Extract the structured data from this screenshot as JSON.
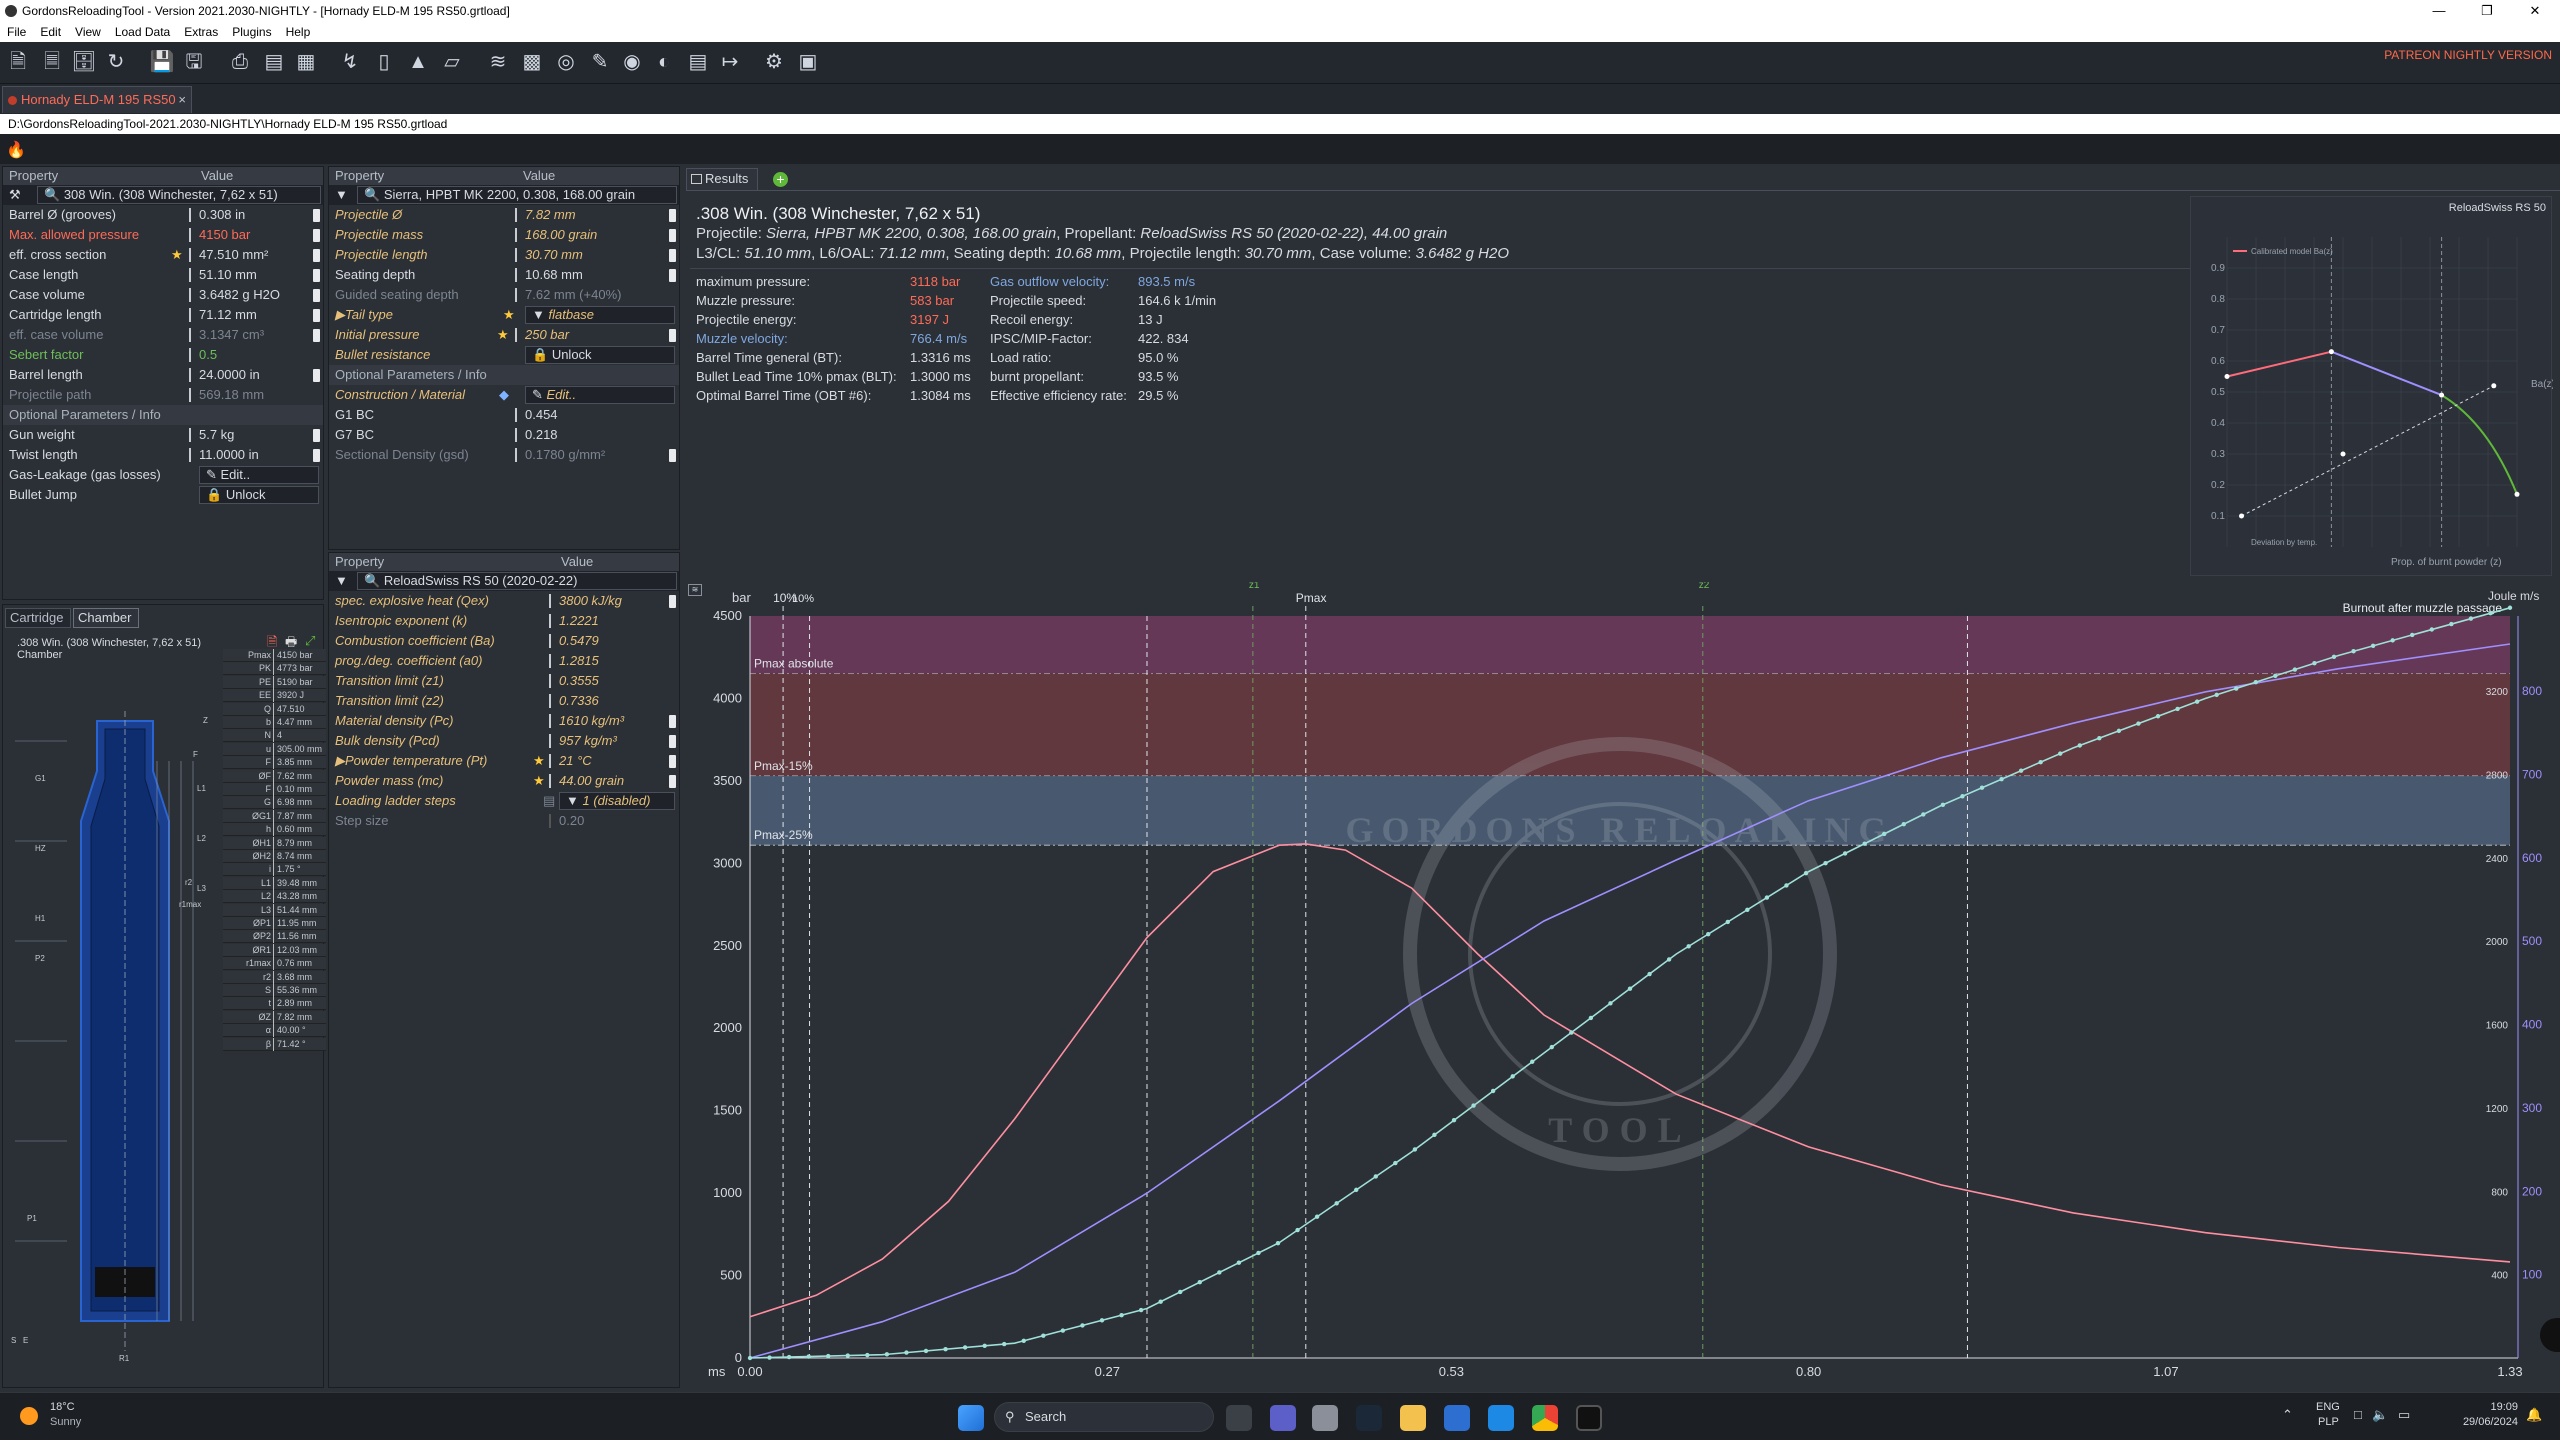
{
  "window": {
    "title": "GordonsReloadingTool - Version 2021.2030-NIGHTLY - [Hornady ELD-M 195 RS50.grtload]"
  },
  "menu": [
    "File",
    "Edit",
    "View",
    "Load Data",
    "Extras",
    "Plugins",
    "Help"
  ],
  "patreon": "PATREON NIGHTLY VERSION",
  "doc_tab": "Hornady ELD-M 195 RS50",
  "path": "D:\\GordonsReloadingTool-2021.2030-NIGHTLY\\Hornady ELD-M 195 RS50.grtload",
  "cartridge_panel": {
    "hdr_property": "Property",
    "hdr_value": "Value",
    "selector": "308 Win. (308 Winchester, 7,62 x 51)",
    "rows": [
      {
        "name": "Barrel Ø (grooves)",
        "value": "0.308 in"
      },
      {
        "name": "Max. allowed pressure",
        "value": "4150 bar"
      },
      {
        "name": "eff. cross section",
        "value": "47.510 mm²"
      },
      {
        "name": "Case length",
        "value": "51.10 mm"
      },
      {
        "name": "Case volume",
        "value": "3.6482 g H2O"
      },
      {
        "name": "Cartridge length",
        "value": "71.12 mm"
      },
      {
        "name": "eff. case volume",
        "value": "3.1347 cm³"
      },
      {
        "name": "Sebert factor",
        "value": "0.5"
      },
      {
        "name": "Barrel length",
        "value": "24.0000 in"
      },
      {
        "name": "Projectile path",
        "value": "569.18 mm"
      }
    ],
    "section_optional": "Optional Parameters / Info",
    "rows2": [
      {
        "name": "Gun weight",
        "value": "5.7 kg"
      },
      {
        "name": "Twist length",
        "value": "11.0000 in"
      },
      {
        "name": "Gas-Leakage (gas losses)",
        "value": "Edit.."
      },
      {
        "name": "Bullet Jump",
        "value": "Unlock"
      }
    ]
  },
  "projectile_panel": {
    "hdr_property": "Property",
    "hdr_value": "Value",
    "selector": "Sierra, HPBT MK 2200, 0.308, 168.00 grain",
    "rows": [
      {
        "name": "Projectile Ø",
        "value": "7.82 mm"
      },
      {
        "name": "Projectile mass",
        "value": "168.00 grain"
      },
      {
        "name": "Projectile length",
        "value": "30.70 mm"
      },
      {
        "name": "Seating depth",
        "value": "10.68 mm"
      },
      {
        "name": "Guided seating depth",
        "value": "7.62 mm (+40%)"
      },
      {
        "name": "Tail type",
        "value": "flatbase"
      },
      {
        "name": "Initial pressure",
        "value": "250 bar"
      },
      {
        "name": "Bullet resistance",
        "value": "Unlock"
      }
    ],
    "section_optional": "Optional Parameters / Info",
    "rows2": [
      {
        "name": "Construction / Material",
        "value": "Edit.."
      },
      {
        "name": "G1 BC",
        "value": "0.454"
      },
      {
        "name": "G7 BC",
        "value": "0.218"
      },
      {
        "name": "Sectional Density (gsd)",
        "value": "0.1780 g/mm²"
      }
    ]
  },
  "powder_panel": {
    "hdr_property": "Property",
    "hdr_value": "Value",
    "selector": "ReloadSwiss RS 50 (2020-02-22)",
    "rows": [
      {
        "name": "spec. explosive heat (Qex)",
        "value": "3800 kJ/kg"
      },
      {
        "name": "Isentropic exponent (k)",
        "value": "1.2221"
      },
      {
        "name": "Combustion coefficient (Ba)",
        "value": "0.5479"
      },
      {
        "name": "prog./deg. coefficient (a0)",
        "value": "1.2815"
      },
      {
        "name": "Transition limit (z1)",
        "value": "0.3555"
      },
      {
        "name": "Transition limit (z2)",
        "value": "0.7336"
      },
      {
        "name": "Material density (Pc)",
        "value": "1610 kg/m³"
      },
      {
        "name": "Bulk density (Pcd)",
        "value": "957 kg/m³"
      },
      {
        "name": "Powder temperature (Pt)",
        "value": "21 °C"
      },
      {
        "name": "Powder mass (mc)",
        "value": "44.00 grain"
      },
      {
        "name": "Loading ladder steps",
        "value": "1 (disabled)"
      },
      {
        "name": "Step size",
        "value": "0.20"
      }
    ]
  },
  "chamber": {
    "tabs": [
      "Cartridge",
      "Chamber"
    ],
    "title1": ".308 Win. (308 Winchester, 7,62 x 51)",
    "title2": "Chamber",
    "rows": [
      {
        "k": "Pmax",
        "v": "4150 bar"
      },
      {
        "k": "PK",
        "v": "4773 bar"
      },
      {
        "k": "PE",
        "v": "5190 bar"
      },
      {
        "k": "EE",
        "v": "3920 J"
      },
      {
        "k": "Q",
        "v": "47.510 mm²"
      },
      {
        "k": "b",
        "v": "4.47 mm"
      },
      {
        "k": "N",
        "v": "4"
      },
      {
        "k": "u",
        "v": "305.00 mm"
      },
      {
        "k": "F",
        "v": "3.85 mm"
      },
      {
        "k": "ØF",
        "v": "7.62 mm"
      },
      {
        "k": "F",
        "v": "0.10 mm"
      },
      {
        "k": "G",
        "v": "6.98 mm"
      },
      {
        "k": "ØG1",
        "v": "7.87 mm"
      },
      {
        "k": "h",
        "v": "0.60 mm"
      },
      {
        "k": "ØH1",
        "v": "8.79 mm"
      },
      {
        "k": "ØH2",
        "v": "8.74 mm"
      },
      {
        "k": "i",
        "v": "1.75 °"
      },
      {
        "k": "L1",
        "v": "39.48 mm"
      },
      {
        "k": "L2",
        "v": "43.28 mm"
      },
      {
        "k": "L3",
        "v": "51.44 mm"
      },
      {
        "k": "ØP1",
        "v": "11.95 mm"
      },
      {
        "k": "ØP2",
        "v": "11.56 mm"
      },
      {
        "k": "ØR1",
        "v": "12.03 mm"
      },
      {
        "k": "r1max",
        "v": "0.76 mm"
      },
      {
        "k": "r2",
        "v": "3.68 mm"
      },
      {
        "k": "S",
        "v": "55.36 mm"
      },
      {
        "k": "t",
        "v": "2.89 mm"
      },
      {
        "k": "ØZ",
        "v": "7.82 mm"
      },
      {
        "k": "α",
        "v": "40.00 °"
      },
      {
        "k": "β",
        "v": "71.42 °"
      }
    ],
    "labels": [
      "G1",
      "HZ",
      "H1",
      "P2",
      "P1",
      "S",
      "E",
      "R1",
      "L1",
      "L2",
      "L3",
      "Z",
      "F",
      "r2",
      "r1max"
    ]
  },
  "results": {
    "tab": "Results",
    "title": ".308 Win. (308 Winchester, 7,62 x 51)",
    "line2_a": "Projectile:",
    "line2_b": "Sierra, HPBT MK 2200, 0.308, 168.00 grain",
    "line2_c": ", Propellant:",
    "line2_d": "ReloadSwiss RS 50 (2020-02-22), 44.00 grain",
    "line3": [
      {
        "k": "L3/CL:",
        "v": "51.10 mm"
      },
      {
        "k": ", L6/OAL:",
        "v": "71.12 mm"
      },
      {
        "k": ", Seating depth:",
        "v": "10.68 mm"
      },
      {
        "k": ", Projectile length:",
        "v": "30.70 mm"
      },
      {
        "k": ", Case volume:",
        "v": "3.6482 g H2O"
      }
    ],
    "col1": [
      {
        "k": "maximum pressure:",
        "v": "3118 bar",
        "c": "red"
      },
      {
        "k": "Muzzle pressure:",
        "v": "583 bar",
        "c": "red"
      },
      {
        "k": "Projectile energy:",
        "v": "3197 J",
        "c": "red"
      },
      {
        "k": "Muzzle velocity:",
        "v": "766.4 m/s",
        "c": "blue"
      },
      {
        "k": "Barrel Time general (BT):",
        "v": "1.3316 ms",
        "c": ""
      },
      {
        "k": "Bullet Lead Time 10% pmax (BLT):",
        "v": "1.3000 ms",
        "c": ""
      },
      {
        "k": "Optimal Barrel Time (OBT #6):",
        "v": "1.3084 ms",
        "c": ""
      }
    ],
    "col2": [
      {
        "k": "Gas outflow velocity:",
        "v": "893.5 m/s",
        "c": "blue"
      },
      {
        "k": "Projectile speed:",
        "v": "164.6 k 1/min",
        "c": ""
      },
      {
        "k": "Recoil energy:",
        "v": "13 J",
        "c": ""
      },
      {
        "k": "IPSC/MIP-Factor:",
        "v": "422. 834",
        "c": ""
      },
      {
        "k": "Load ratio:",
        "v": "95.0 %",
        "c": ""
      },
      {
        "k": "burnt propellant:",
        "v": "93.5 %",
        "c": ""
      },
      {
        "k": "Effective efficiency rate:",
        "v": "29.5 %",
        "c": ""
      }
    ]
  },
  "colors": {
    "pressure": "#ff8fa0",
    "energy": "#9f8fff",
    "velocity": "#9fe0d8",
    "accent": "#ff6b57"
  },
  "chart_data": [
    {
      "type": "line",
      "title": "ReloadSwiss RS 50",
      "xlabel": "Prop. of burnt powder (z)",
      "ylabel": "Ba(z)",
      "ylim": [
        0,
        1.0
      ],
      "legend": [
        "Calibrated model Ba(z)",
        "Deviation by temp."
      ],
      "y_ticks": [
        "0.1",
        "0.2",
        "0.3",
        "0.4",
        "0.5",
        "0.6",
        "0.7",
        "0.8",
        "0.9"
      ],
      "series": [
        {
          "name": "Calibrated model Ba(z)",
          "x": [
            0,
            0.36,
            0.74,
            1.0
          ],
          "y": [
            0.55,
            0.63,
            0.49,
            0.17
          ]
        }
      ]
    },
    {
      "type": "line",
      "xlabel": "ms",
      "x_ticks": [
        "0.00",
        "0.27",
        "0.53",
        "0.80",
        "1.07",
        "1.33"
      ],
      "y_left_label": "bar",
      "y_left_ticks": [
        "0",
        "500",
        "1000",
        "1500",
        "2000",
        "2500",
        "3000",
        "3500",
        "4000",
        "4500"
      ],
      "y_right_label1": "Joule",
      "y_right_label2": "m/s",
      "y_right_joule": [
        "400",
        "800",
        "1200",
        "1600",
        "2000",
        "2400",
        "2800",
        "3200"
      ],
      "y_right_ms": [
        "100",
        "200",
        "300",
        "400",
        "500",
        "600",
        "700",
        "800"
      ],
      "xlim": [
        0,
        1.33
      ],
      "ylim": [
        0,
        4500
      ],
      "bands": [
        {
          "name": "Pmax absolute",
          "from": 4150,
          "to": 4500
        },
        {
          "name": "Pmax-15%",
          "from": 3530,
          "to": 4150
        },
        {
          "name": "Pmax-25%",
          "from": 3110,
          "to": 3530
        }
      ],
      "markers": [
        {
          "label": "10%",
          "x": 0.025
        },
        {
          "label": "z1",
          "x": 0.38
        },
        {
          "label": "Pmax",
          "x": 0.42
        },
        {
          "label": "z2",
          "x": 0.72
        }
      ],
      "annotation": "Burnout after muzzle passage",
      "series": [
        {
          "x": [
            0,
            0.05,
            0.1,
            0.15,
            0.2,
            0.25,
            0.3,
            0.35,
            0.4,
            0.42,
            0.45,
            0.5,
            0.55,
            0.6,
            0.7,
            0.8,
            0.9,
            1.0,
            1.1,
            1.2,
            1.33
          ],
          "y": [
            250,
            380,
            600,
            950,
            1450,
            2000,
            2550,
            2950,
            3110,
            3118,
            3080,
            2850,
            2450,
            2080,
            1600,
            1280,
            1050,
            880,
            760,
            670,
            583
          ]
        },
        {
          "x": [
            0,
            0.1,
            0.2,
            0.3,
            0.4,
            0.5,
            0.6,
            0.7,
            0.8,
            0.9,
            1.0,
            1.1,
            1.2,
            1.33
          ],
          "y": [
            0,
            220,
            520,
            1000,
            1560,
            2150,
            2650,
            3020,
            3380,
            3640,
            3850,
            4040,
            4180,
            4330
          ]
        },
        {
          "x": [
            0,
            0.1,
            0.2,
            0.3,
            0.4,
            0.5,
            0.6,
            0.7,
            0.8,
            0.9,
            1.0,
            1.1,
            1.2,
            1.33
          ],
          "y": [
            0,
            20,
            90,
            300,
            700,
            1250,
            1850,
            2450,
            2950,
            3350,
            3700,
            4000,
            4260,
            4550
          ]
        }
      ]
    }
  ],
  "taskbar": {
    "weather_temp": "18°C",
    "weather_desc": "Sunny",
    "search": "Search",
    "lang1": "ENG",
    "lang2": "PLP",
    "time": "19:09",
    "date": "29/06/2024"
  }
}
